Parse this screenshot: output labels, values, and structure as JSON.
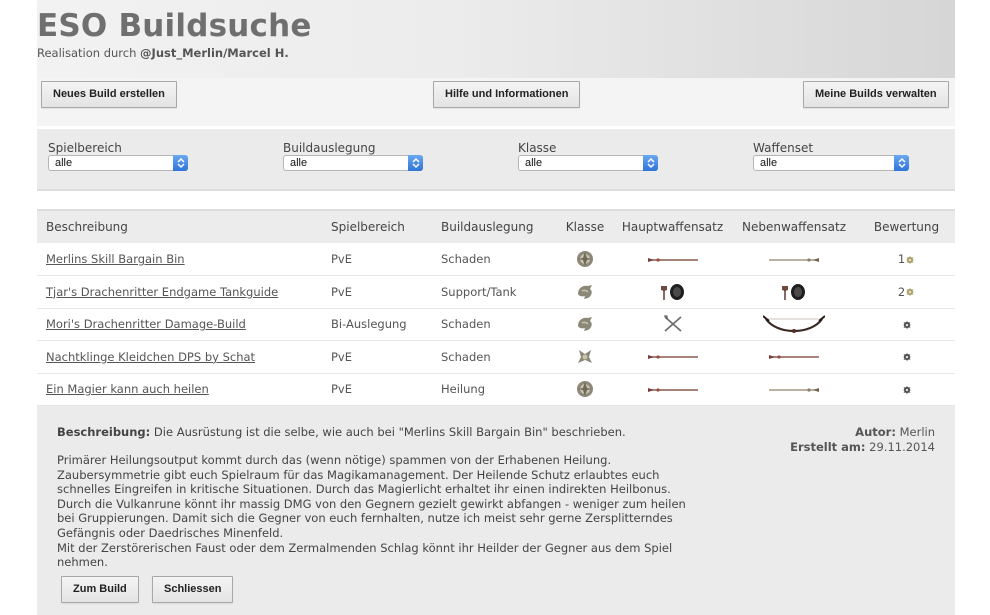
{
  "header": {
    "title": "ESO Buildsuche",
    "subtitle_prefix": "Realisation durch ",
    "subtitle_author": "@Just_Merlin/Marcel H."
  },
  "toolbar": {
    "new_build": "Neues Build erstellen",
    "help": "Hilfe und Informationen",
    "my_builds": "Meine Builds verwalten"
  },
  "filters": [
    {
      "label": "Spielbereich",
      "value": "alle"
    },
    {
      "label": "Buildauslegung",
      "value": "alle"
    },
    {
      "label": "Klasse",
      "value": "alle"
    },
    {
      "label": "Waffenset",
      "value": "alle"
    }
  ],
  "table": {
    "headers": [
      "Beschreibung",
      "Spielbereich",
      "Buildauslegung",
      "Klasse",
      "Hauptwaffensatz",
      "Nebenwaffensatz",
      "Bewertung"
    ],
    "rows": [
      {
        "name": "Merlins Skill Bargain Bin",
        "area": "PvE",
        "role": "Schaden",
        "class_icon": "sorcerer-icon",
        "main_weapon": "staff-icon",
        "off_weapon": "staff-icon",
        "rating": "1"
      },
      {
        "name": "Tjar's Drachenritter Endgame Tankguide",
        "area": "PvE",
        "role": "Support/Tank",
        "class_icon": "dragonknight-icon",
        "main_weapon": "sword-shield-icon",
        "off_weapon": "sword-shield-icon",
        "rating": "2"
      },
      {
        "name": "Mori's Drachenritter Damage-Build",
        "area": "Bi-Auslegung",
        "role": "Schaden",
        "class_icon": "dragonknight-icon",
        "main_weapon": "dual-wield-icon",
        "off_weapon": "bow-icon",
        "rating": ""
      },
      {
        "name": "Nachtklinge Kleidchen DPS by Schat",
        "area": "PvE",
        "role": "Schaden",
        "class_icon": "nightblade-icon",
        "main_weapon": "staff-icon",
        "off_weapon": "staff-icon",
        "rating": ""
      },
      {
        "name": "Ein Magier kann auch heilen",
        "area": "PvE",
        "role": "Heilung",
        "class_icon": "sorcerer-icon",
        "main_weapon": "staff-icon",
        "off_weapon": "staff-icon",
        "rating": ""
      }
    ]
  },
  "detail": {
    "desc_label": "Beschreibung:",
    "desc_text": " Die Ausrüstung ist die selbe, wie auch bei \"Merlins Skill Bargain Bin\" beschrieben.",
    "author_label": "Autor:",
    "author": " Merlin",
    "created_label": "Erstellt am:",
    "created": " 29.11.2014",
    "body": [
      "Primärer Heilungsoutput kommt durch das (wenn nötige) spammen von der Erhabenen Heilung.",
      "Zaubersymmetrie gibt euch Spielraum für das Magikamanagement. Der Heilende Schutz erlaubtes euch",
      "schnelles Eingreifen in kritische Situationen. Durch das Magierlicht erhaltet ihr einen indirekten Heilbonus.",
      "Durch die Vulkanrune könnt ihr massig DMG von den Gegnern gezielt gewirkt abfangen - weniger zum heilen",
      "bei Gruppierungen. Damit sich die Gegner von euch fernhalten, nutze ich meist sehr gerne Zersplitterndes",
      "Gefängnis oder Daedrisches Minenfeld.",
      "Mit der Zerstörerischen Faust oder dem Zermalmenden Schlag könnt ihr Heilder der Gegner aus dem Spiel",
      "nehmen."
    ],
    "to_build": "Zum Build",
    "close": "Schliessen"
  }
}
